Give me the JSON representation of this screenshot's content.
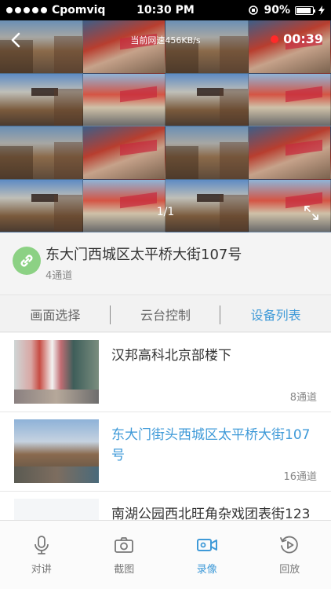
{
  "status_bar": {
    "carrier": "Cpomviq",
    "time": "10:30 PM",
    "battery": "90%"
  },
  "video": {
    "speed_text": "当前网速456KB/s",
    "rec_time": "00:39",
    "page_indicator": "1/1"
  },
  "device": {
    "name": "东大门西城区太平桥大街107号",
    "channels": "4通道"
  },
  "tabs": [
    {
      "label": "画面选择"
    },
    {
      "label": "云台控制"
    },
    {
      "label": "设备列表"
    }
  ],
  "devices": [
    {
      "title": "汉邦高科北京部楼下",
      "channels": "8通道"
    },
    {
      "title": "东大门街头西城区太平桥大街107号",
      "channels": "16通道"
    },
    {
      "title": "南湖公园西北旺角杂戏团表街123"
    }
  ],
  "toolbar": [
    {
      "label": "对讲",
      "icon": "microphone-icon"
    },
    {
      "label": "截图",
      "icon": "camera-icon"
    },
    {
      "label": "录像",
      "icon": "video-icon"
    },
    {
      "label": "回放",
      "icon": "playback-icon"
    }
  ],
  "colors": {
    "accent": "#3f9ad8",
    "rec": "#ff2a2a",
    "link_badge": "#8cd184"
  }
}
